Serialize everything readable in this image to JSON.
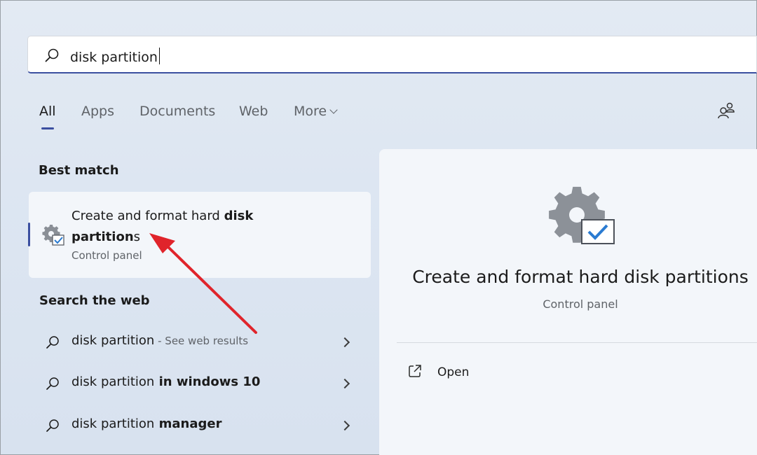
{
  "search": {
    "value": "disk partition"
  },
  "tabs": [
    {
      "label": "All"
    },
    {
      "label": "Apps"
    },
    {
      "label": "Documents"
    },
    {
      "label": "Web"
    },
    {
      "label": "More"
    }
  ],
  "best_match": {
    "section_label": "Best match",
    "title_prefix": "Create and format hard ",
    "title_bold_1": "disk",
    "title_bold_2": "partition",
    "title_suffix": "s",
    "subtitle": "Control panel"
  },
  "web": {
    "section_label": "Search the web",
    "results": [
      {
        "query": "disk partition",
        "suffix": " - See web results"
      },
      {
        "query": "disk partition",
        "suffix": " in windows 10"
      },
      {
        "query": "disk partition",
        "suffix": " manager"
      }
    ]
  },
  "detail": {
    "title": "Create and format hard disk partitions",
    "subtitle": "Control panel",
    "open_label": "Open"
  },
  "colors": {
    "accent": "#3b4fa0",
    "annotation_arrow": "#e0242b"
  },
  "icons": {
    "search": "search-icon",
    "people": "people-icon",
    "settings": "gear-checkbox-icon",
    "open": "open-external-icon",
    "chevron": "chevron-right-icon"
  }
}
